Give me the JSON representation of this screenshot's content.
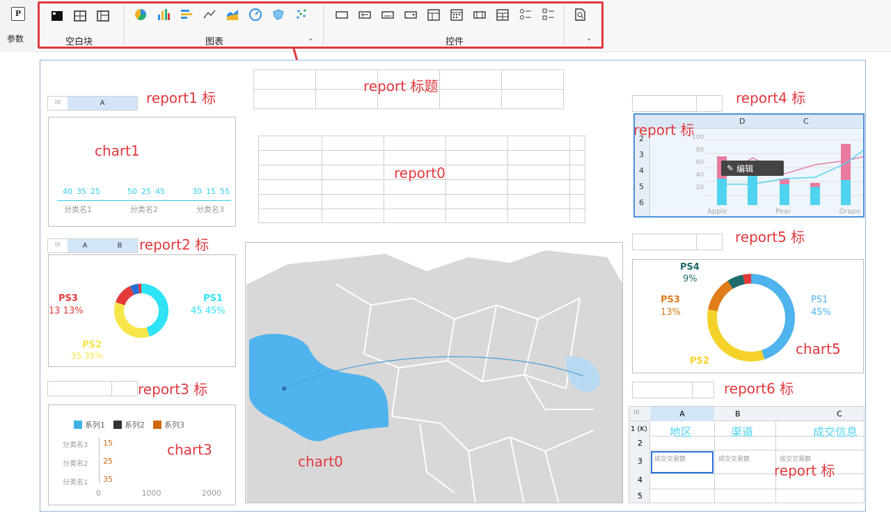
{
  "toolbar": {
    "param_label": "参数",
    "p_button": "P",
    "groups": [
      {
        "label": "空白块"
      },
      {
        "label": "图表"
      },
      {
        "label": "控件"
      }
    ]
  },
  "labels": {
    "report1_title": "report1 标",
    "report_title": "report 标题",
    "report4_title": "report4 标",
    "report_sub": "report 标",
    "chart1": "chart1",
    "report0": "report0",
    "report2_title": "report2 标",
    "report5_title": "report5 标",
    "chart5": "chart5",
    "report3_title": "report3 标",
    "report6_title": "report6 标",
    "chart3": "chart3",
    "chart0": "chart0",
    "report_cell": "report 标"
  },
  "edit_button": "编辑",
  "chart1": {
    "values": [
      "40",
      "35",
      "25",
      "50",
      "25",
      "45",
      "30",
      "15",
      "55"
    ],
    "categories": [
      "分类名1",
      "分类名2",
      "分类名3"
    ]
  },
  "chart2": {
    "ps3": "PS3",
    "ps3_val": "13  13%",
    "ps1": "PS1",
    "ps1_val": "45  45%",
    "ps2": "PS2",
    "ps2_val": "35  35%"
  },
  "chart5": {
    "ps4": "PS4",
    "ps4_pct": "9%",
    "ps3": "PS3",
    "ps3_pct": "13%",
    "ps1": "PS1",
    "ps1_pct": "45%",
    "ps2": "PS2"
  },
  "chart3": {
    "legend": [
      "系列1",
      "系列2",
      "系列3"
    ],
    "categories": [
      "分类名3",
      "分类名2",
      "分类名1"
    ],
    "values": [
      "15",
      "25",
      "35"
    ],
    "ticks": [
      "0",
      "1000",
      "2000"
    ]
  },
  "report4_grid": {
    "cols": [
      "D",
      "C"
    ],
    "rows": [
      "2",
      "3",
      "4",
      "5",
      "6"
    ],
    "x_labels": [
      "Apple",
      "Pear",
      "Grape"
    ],
    "y_labels": [
      "100",
      "80",
      "60",
      "40",
      "20"
    ]
  },
  "report6_grid": {
    "cols": [
      "A",
      "B",
      "C"
    ],
    "rows": [
      "1 (K)",
      "2",
      "3",
      "4",
      "5"
    ],
    "headers": [
      "地区",
      "渠道",
      "成交信息"
    ],
    "cells": [
      "成交交易额",
      "成交交易额",
      "成交交易额"
    ]
  },
  "report1_grid": {
    "col": "A"
  },
  "report2_grid": {
    "cols": [
      "A",
      "B"
    ]
  }
}
